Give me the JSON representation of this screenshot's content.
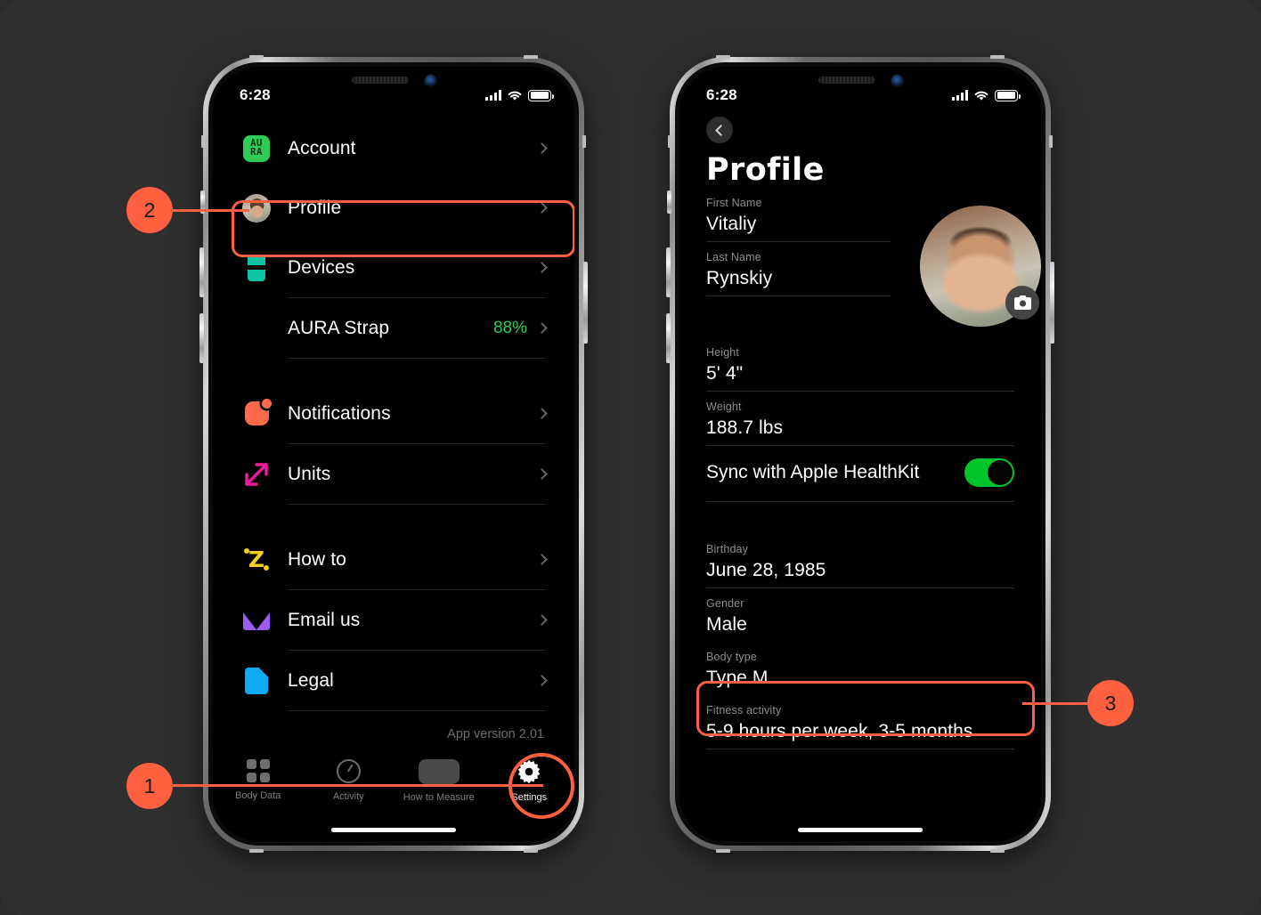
{
  "statusbar": {
    "time": "6:28"
  },
  "settings": {
    "rows": [
      {
        "label": "Account",
        "icon": "aura-logo-icon",
        "value": ""
      },
      {
        "label": "Profile",
        "icon": "avatar-icon",
        "value": ""
      },
      {
        "label": "Devices",
        "icon": "device-strap-icon",
        "value": ""
      },
      {
        "label": "AURA Strap",
        "icon": "none",
        "value": "88%"
      },
      {
        "label": "Notifications",
        "icon": "bell-badge-icon",
        "value": ""
      },
      {
        "label": "Units",
        "icon": "resize-arrow-icon",
        "value": ""
      },
      {
        "label": "How to",
        "icon": "z-sleep-icon",
        "value": ""
      },
      {
        "label": "Email us",
        "icon": "envelope-icon",
        "value": ""
      },
      {
        "label": "Legal",
        "icon": "document-icon",
        "value": ""
      }
    ],
    "aura_logo_line1": "AU",
    "aura_logo_line2": "RA",
    "app_version": "App version 2.01",
    "battery_color": "#2ecc55"
  },
  "tabbar": {
    "tabs": [
      {
        "label": "Body Data",
        "icon": "grid-icon",
        "active": false
      },
      {
        "label": "Activity",
        "icon": "activity-icon",
        "active": false
      },
      {
        "label": "How to Measure",
        "icon": "measure-icon",
        "active": false
      },
      {
        "label": "Settings",
        "icon": "gear-icon",
        "active": true
      }
    ]
  },
  "profile": {
    "title": "Profile",
    "fields": [
      {
        "label": "First Name",
        "value": "Vitaliy"
      },
      {
        "label": "Last Name",
        "value": "Rynskiy"
      },
      {
        "label": "Height",
        "value": "5' 4\""
      },
      {
        "label": "Weight",
        "value": "188.7 lbs"
      },
      {
        "label": "Birthday",
        "value": "June 28, 1985"
      },
      {
        "label": "Gender",
        "value": "Male"
      },
      {
        "label": "Body type",
        "value": "Type M"
      },
      {
        "label": "Fitness activity",
        "value": "5-9 hours per week, 3-5 months"
      }
    ],
    "sync": {
      "label": "Sync with Apple HealthKit",
      "enabled": true,
      "on_color": "#00c62b"
    }
  },
  "callouts": [
    {
      "number": "1",
      "target": "settings-tab"
    },
    {
      "number": "2",
      "target": "profile-row"
    },
    {
      "number": "3",
      "target": "body-type-field"
    }
  ],
  "accent_color": "#ff6040"
}
